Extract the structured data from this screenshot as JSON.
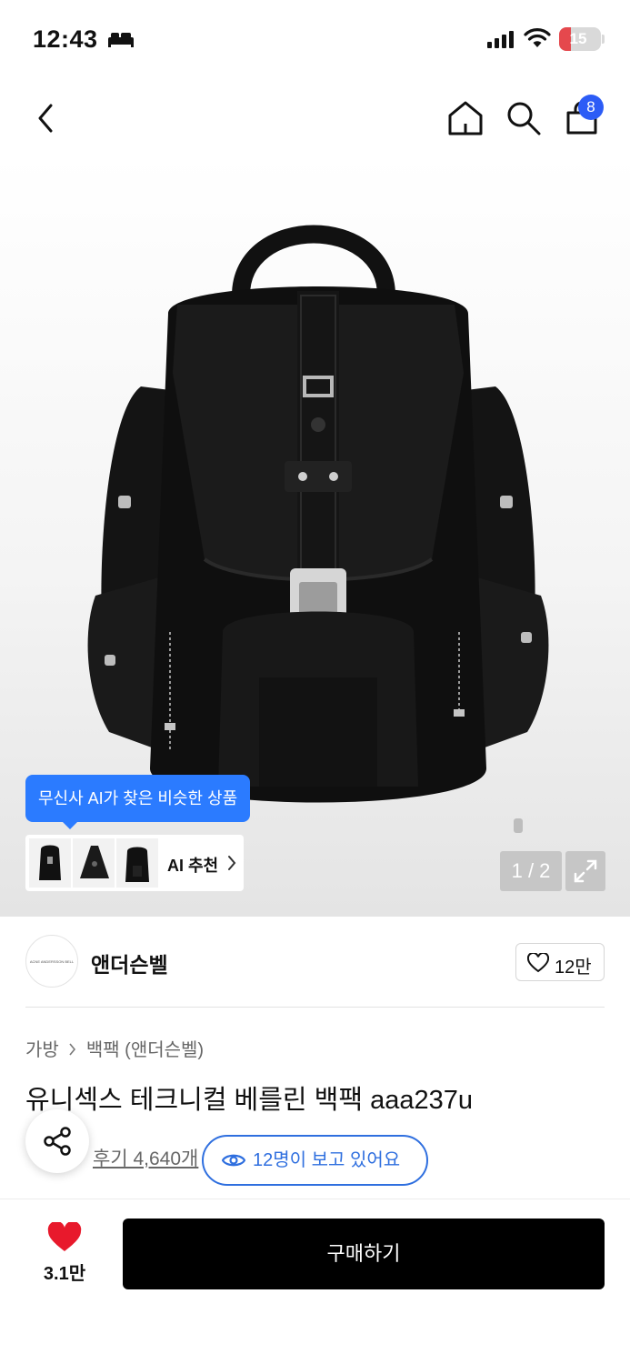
{
  "status_bar": {
    "time": "12:43",
    "battery": "15"
  },
  "nav": {
    "cart_count": "8"
  },
  "gallery": {
    "ai_tooltip": "무신사 AI가 찾은 비슷한 상품",
    "ai_label": "AI 추천",
    "page_indicator": "1 / 2"
  },
  "brand": {
    "logo_text": "ACNE ANDERSSON BELL",
    "name": "앤더슨벨",
    "like_count": "12만"
  },
  "product": {
    "breadcrumb": [
      "가방",
      "백팩 (앤더슨벨)"
    ],
    "title": "유니섹스 테크니컬 베를린 백팩 aaa237u",
    "review_link": "후기 4,640개",
    "viewers": "12명이 보고 있어요"
  },
  "footer": {
    "like_count": "3.1만",
    "buy_label": "구매하기"
  },
  "colors": {
    "accent_blue": "#2b7bff",
    "badge_blue": "#2c5cf6",
    "heart_red": "#e8192c",
    "buy_black": "#000000"
  }
}
